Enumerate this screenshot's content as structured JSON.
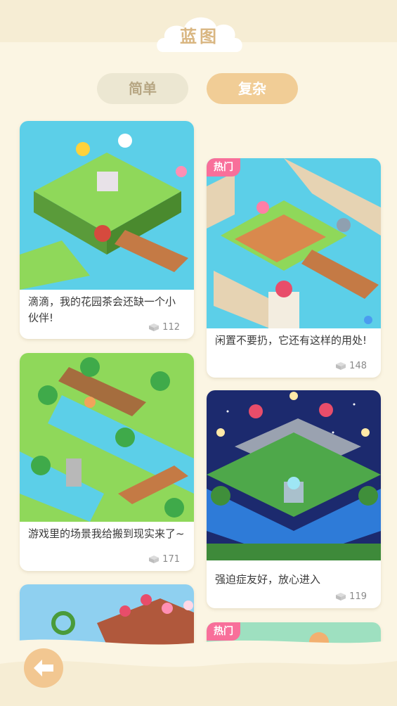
{
  "header": {
    "title": "蓝图"
  },
  "tabs": [
    {
      "label": "简单",
      "active": false
    },
    {
      "label": "复杂",
      "active": true
    }
  ],
  "cards": [
    {
      "title": "滴滴，我的花园茶会还缺一个小伙伴!",
      "count": "112",
      "hot": false
    },
    {
      "title": "闲置不要扔，它还有这样的用处!",
      "count": "148",
      "hot": true,
      "badge": "热门"
    },
    {
      "title": "游戏里的场景我给搬到现实来了~",
      "count": "171",
      "hot": false
    },
    {
      "title": "强迫症友好，放心进入",
      "count": "119",
      "hot": false
    },
    {
      "title": "",
      "count": "",
      "hot": false
    },
    {
      "title": "",
      "count": "",
      "hot": true,
      "badge": "热门"
    }
  ],
  "icons": {
    "count_icon": "block-icon",
    "back": "arrow-left-icon"
  },
  "colors": {
    "accent": "#f1cd96",
    "hot": "#f86f9a",
    "background": "#fbf5e3"
  }
}
